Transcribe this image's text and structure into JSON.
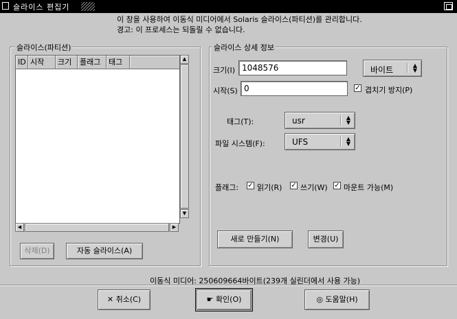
{
  "window": {
    "title": "슬라이스 편집기"
  },
  "info": {
    "line1": "이 창을 사용하여 이동식 미디어에서 Solaris 슬라이스(파티션)를 관리합니다.",
    "line2": "경고: 이 프로세스는 되돌릴 수 없습니다."
  },
  "slices_panel": {
    "title": "슬라이스(파티션)",
    "columns": [
      "ID",
      "시작",
      "크기",
      "플래그",
      "태그"
    ],
    "rows": [],
    "delete_label": "삭제(D)",
    "auto_slice_label": "자동 슬라이스(A)"
  },
  "details_panel": {
    "title": "슬라이스 상세 정보",
    "size_label": "크기(I)",
    "size_value": "1048576",
    "unit_value": "바이트",
    "start_label": "시작(S)",
    "start_value": "0",
    "overlap_label": "겹치기 방지(P)",
    "overlap_checked": true,
    "tag_label": "태그(T):",
    "tag_value": "usr",
    "fs_label": "파일 시스템(F):",
    "fs_value": "UFS",
    "flags_label": "플래그:",
    "flag_read_label": "읽기(R)",
    "flag_read_checked": true,
    "flag_write_label": "쓰기(W)",
    "flag_write_checked": true,
    "flag_mount_label": "마운트 가능(M)",
    "flag_mount_checked": true,
    "new_label": "새로 만들기(N)",
    "change_label": "변경(U)"
  },
  "status": {
    "media_text": "이동식 미디어: 250609664바이트(239개 실린더에서 사용 가능)"
  },
  "footer": {
    "cancel_label": "취소(C)",
    "ok_label": "확인(O)",
    "help_label": "도움말(H)"
  },
  "icons": {
    "cancel": "x-icon",
    "ok": "hand-pointer-icon",
    "help": "lifebuoy-icon"
  }
}
